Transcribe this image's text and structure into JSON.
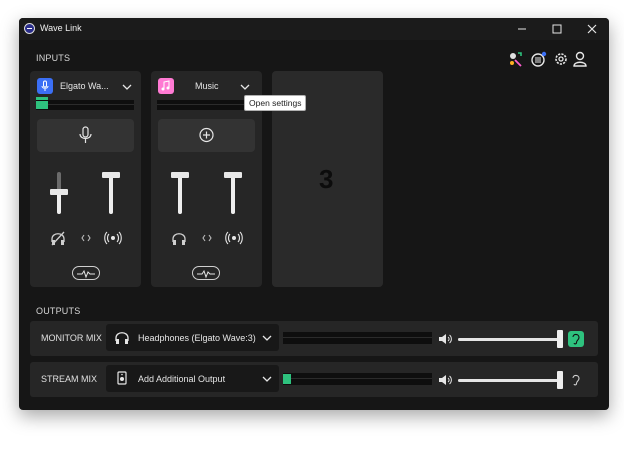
{
  "app": {
    "title": "Wave Link"
  },
  "sections": {
    "inputs": "INPUTS",
    "outputs": "OUTPUTS"
  },
  "toolbar": {
    "icons": [
      "effects-icon",
      "wave-devices-icon",
      "settings-icon",
      "account-icon"
    ]
  },
  "inputs": [
    {
      "name": "Elgato Wa...",
      "chip_color": "#3b6ff5",
      "chip_icon": "microphone-icon",
      "level": 0.1,
      "main_fader": 0.5,
      "stream_fader": 0.95
    },
    {
      "name": "Music",
      "chip_color": "#ff7ad3",
      "chip_icon": "music-note-icon",
      "level": 0,
      "main_fader": 0.95,
      "stream_fader": 0.95
    }
  ],
  "add_input_card": {
    "label": "3"
  },
  "tooltip": {
    "text": "Open settings"
  },
  "outputs": [
    {
      "label": "MONITOR MIX",
      "device": "Headphones (Elgato Wave:3)",
      "level": 0,
      "volume": 0.99,
      "ear_color": "#2ec27e"
    },
    {
      "label": "STREAM MIX",
      "device": "Add Additional Output",
      "level": 0.05,
      "volume": 0.99
    }
  ],
  "colors": {
    "accent_green": "#2ec27e",
    "window_bg": "#161616",
    "card_bg": "#262626"
  }
}
